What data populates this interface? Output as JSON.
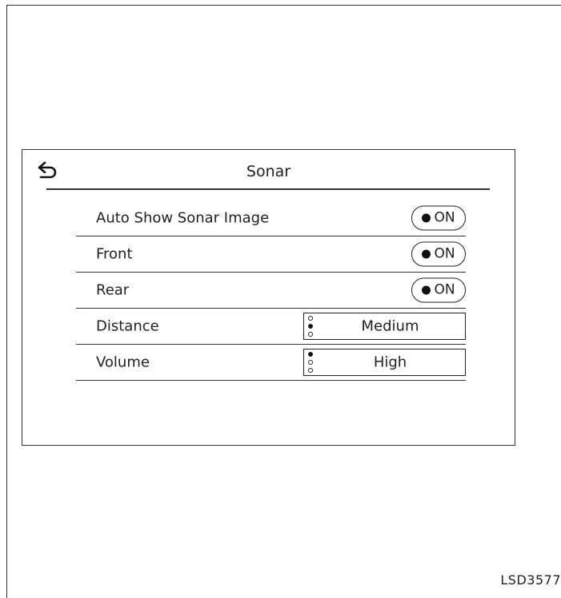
{
  "screen": {
    "title": "Sonar",
    "back_icon": "back-arrow-icon",
    "settings": [
      {
        "label": "Auto Show Sonar Image",
        "control": "toggle",
        "value": "ON",
        "on": true
      },
      {
        "label": "Front",
        "control": "toggle",
        "value": "ON",
        "on": true
      },
      {
        "label": "Rear",
        "control": "toggle",
        "value": "ON",
        "on": true
      },
      {
        "label": "Distance",
        "control": "selector",
        "value": "Medium",
        "level": 2,
        "levels": 3
      },
      {
        "label": "Volume",
        "control": "selector",
        "value": "High",
        "level": 3,
        "levels": 3
      }
    ]
  },
  "figure_id": "LSD3577"
}
